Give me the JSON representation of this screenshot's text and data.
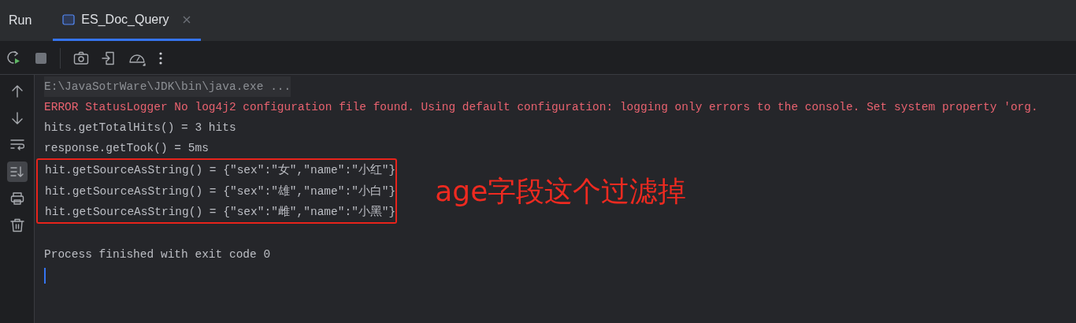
{
  "panel_title": "Run",
  "tabs": [
    {
      "label": "ES_Doc_Query",
      "selected": true,
      "closable": true
    }
  ],
  "gutter_tools": [
    {
      "kind": "up",
      "on": false
    },
    {
      "kind": "down",
      "on": false
    },
    {
      "kind": "wrap",
      "on": false
    },
    {
      "kind": "scroll-end",
      "on": true
    },
    {
      "kind": "print",
      "on": false
    },
    {
      "kind": "clear",
      "on": false
    }
  ],
  "console": {
    "lines": [
      {
        "kind": "command",
        "text": "E:\\JavaSotrWare\\JDK\\bin\\java.exe ...",
        "highlighted": false
      },
      {
        "kind": "error",
        "text": "ERROR StatusLogger No log4j2 configuration file found. Using default configuration: logging only errors to the console. Set system property 'org.",
        "highlighted": false
      },
      {
        "kind": "output",
        "text": "hits.getTotalHits() = 3 hits",
        "highlighted": false
      },
      {
        "kind": "output",
        "text": "response.getTook() = 5ms",
        "highlighted": false
      },
      {
        "kind": "output",
        "text": "hit.getSourceAsString() = {\"sex\":\"女\",\"name\":\"小红\"}",
        "highlighted": true
      },
      {
        "kind": "output",
        "text": "hit.getSourceAsString() = {\"sex\":\"雄\",\"name\":\"小白\"}",
        "highlighted": true
      },
      {
        "kind": "output",
        "text": "hit.getSourceAsString() = {\"sex\":\"雌\",\"name\":\"小黑\"}",
        "highlighted": true
      }
    ],
    "annotation": "age字段这个过滤掉",
    "exit_message": "Process finished with exit code 0",
    "caret_visible": true
  }
}
